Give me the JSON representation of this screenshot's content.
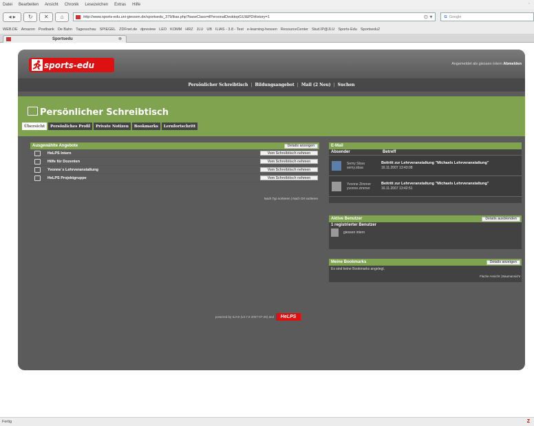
{
  "browser": {
    "menu": [
      "Datei",
      "Bearbeiten",
      "Ansicht",
      "Chronik",
      "Lesezeichen",
      "Extras",
      "Hilfe"
    ],
    "url": "http://www.sports-edu.uni-giessen.de/sportsedu_379/ilias.php?baseClass=ilPersonalDesktopGUI&PDHistory=1",
    "search_placeholder": "Google",
    "bookmarks": [
      "WEB.DE",
      "Amazon",
      "Postbank",
      "De Bahn",
      "Tagesschau",
      "SPIEGEL",
      "ZDFnet.de",
      "dpreview",
      "LEO",
      "KOMM",
      "HRZ",
      "JLU",
      "UB",
      "ILIAS - 3.8 - Test",
      "e-learning-hessen",
      "ResourceCenter",
      "Stud.IP@JLU",
      "Sports-Edu",
      "Sportsedu2"
    ],
    "tab_title": "Sportsedu",
    "status": "Fertig"
  },
  "site": {
    "logo_text": "sports-edu",
    "logged_in_text": "Angemeldet als giessen intern",
    "logout_label": "Abmelden",
    "nav": [
      "Persönlicher Schreibtisch",
      "Bildungsangebot",
      "Mail (2 Neu)",
      "Suchen"
    ],
    "page_title": "Persönlicher Schreibtisch",
    "subtabs": [
      "Übersicht",
      "Persönliches Profil",
      "Private Notizen",
      "Bookmarks",
      "Lernfortschritt"
    ]
  },
  "offers": {
    "title": "Ausgewählte Angebote",
    "details_label": "Details anzeigen",
    "items": [
      {
        "label": "HeLPS Intern",
        "button": "Vom Schreibtisch nehmen"
      },
      {
        "label": "Hilfe für Dozenten",
        "button": "Vom Schreibtisch nehmen"
      },
      {
        "label": "Yvonne´s Lehrveranstaltung",
        "button": "Vom Schreibtisch nehmen"
      },
      {
        "label": "HeLPS Projektgruppe",
        "button": "Vom Schreibtisch nehmen"
      }
    ],
    "sort_text": "Nach Typ sortieren | Nach Ort sortieren"
  },
  "mail": {
    "title": "E-Mail",
    "col_sender": "Absender",
    "col_subject": "Betreff",
    "rows": [
      {
        "sender_name": "Semy Sbaa",
        "sender_login": "semy.sbaa",
        "subject": "Beitritt zur Lehrveranstaltung \"Michaels Lehrveranstaltung\"",
        "date": "16.11.2007 13:43:08"
      },
      {
        "sender_name": "Yvonne Zimmer",
        "sender_login": "yvonne.zimmer",
        "subject": "Beitritt zur Lehrveranstaltung \"Michaels Lehrveranstaltung\"",
        "date": "16.11.2007 13:42:51"
      }
    ]
  },
  "users": {
    "title": "Aktive Benutzer",
    "details_label": "Details ausblenden",
    "count_text": "1 registrierter Benutzer",
    "user": "giessen intern"
  },
  "bookmarks_panel": {
    "title": "Meine Bookmarks",
    "details_label": "Details anzeigen",
    "empty_text": "Es sind keine Bookmarks angelegt.",
    "view_text": "Flache Ansicht | Baumansicht"
  },
  "footer": {
    "powered_text": "powered by ILIAS (v3.7.9 2007-07-26) and",
    "helps_label": "HeLPS"
  }
}
